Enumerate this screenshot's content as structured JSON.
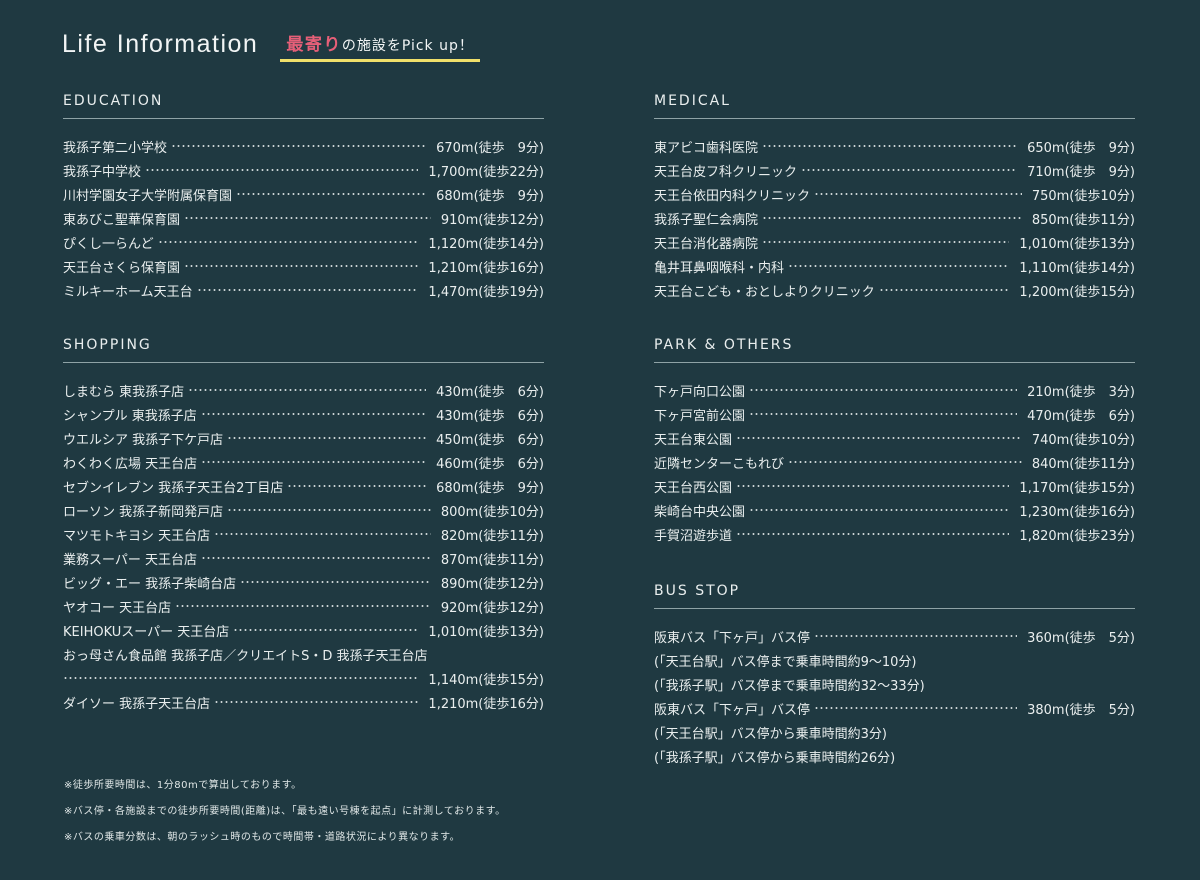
{
  "header": {
    "title": "Life Information",
    "pickup_highlight": "最寄り",
    "pickup_rest": "の施設をPick up！"
  },
  "education": {
    "title": "EDUCATION",
    "rows": [
      {
        "name": "我孫子第二小学校",
        "dist": "670m(徒歩　9分)"
      },
      {
        "name": "我孫子中学校",
        "dist": "1,700m(徒歩22分)"
      },
      {
        "name": "川村学園女子大学附属保育園",
        "dist": "680m(徒歩　9分)"
      },
      {
        "name": "東あびこ聖華保育園",
        "dist": "910m(徒歩12分)"
      },
      {
        "name": "ぴくし一らんど",
        "dist": "1,120m(徒歩14分)"
      },
      {
        "name": "天王台さくら保育園",
        "dist": "1,210m(徒歩16分)"
      },
      {
        "name": "ミルキーホーム天王台",
        "dist": "1,470m(徒歩19分)"
      }
    ]
  },
  "shopping": {
    "title": "SHOPPING",
    "rows": [
      {
        "name": "しまむら 東我孫子店",
        "dist": "430m(徒歩　6分)"
      },
      {
        "name": "シャンプル 東我孫子店",
        "dist": "430m(徒歩　6分)"
      },
      {
        "name": "ウエルシア 我孫子下ケ戸店",
        "dist": "450m(徒歩　6分)"
      },
      {
        "name": "わくわく広場 天王台店",
        "dist": "460m(徒歩　6分)"
      },
      {
        "name": "セブンイレブン 我孫子天王台2丁目店",
        "dist": "680m(徒歩　9分)"
      },
      {
        "name": "ローソン 我孫子新岡発戸店",
        "dist": "800m(徒歩10分)"
      },
      {
        "name": "マツモトキヨシ 天王台店",
        "dist": "820m(徒歩11分)"
      },
      {
        "name": "業務スーパー 天王台店",
        "dist": "870m(徒歩11分)"
      },
      {
        "name": "ビッグ・エー 我孫子柴崎台店",
        "dist": "890m(徒歩12分)"
      },
      {
        "name": "ヤオコー 天王台店",
        "dist": "920m(徒歩12分)"
      },
      {
        "name": "KEIHOKUスーパー 天王台店",
        "dist": "1,010m(徒歩13分)"
      }
    ],
    "long_name": "おっ母さん食品館 我孫子店／クリエイトS・D 我孫子天王台店",
    "long_dist": "1,140m(徒歩15分)",
    "last": {
      "name": "ダイソー 我孫子天王台店",
      "dist": "1,210m(徒歩16分)"
    }
  },
  "medical": {
    "title": "MEDICAL",
    "rows": [
      {
        "name": "東アビコ歯科医院",
        "dist": "650m(徒歩　9分)"
      },
      {
        "name": "天王台皮フ科クリニック",
        "dist": "710m(徒歩　9分)"
      },
      {
        "name": "天王台依田内科クリニック",
        "dist": "750m(徒歩10分)"
      },
      {
        "name": "我孫子聖仁会病院",
        "dist": "850m(徒歩11分)"
      },
      {
        "name": "天王台消化器病院",
        "dist": "1,010m(徒歩13分)"
      },
      {
        "name": "亀井耳鼻咽喉科・内科",
        "dist": "1,110m(徒歩14分)"
      },
      {
        "name": "天王台こども・おとしよりクリニック",
        "dist": "1,200m(徒歩15分)"
      }
    ]
  },
  "park": {
    "title": "PARK & OTHERS",
    "rows": [
      {
        "name": "下ヶ戸向口公園",
        "dist": "210m(徒歩　3分)"
      },
      {
        "name": "下ヶ戸宮前公園",
        "dist": "470m(徒歩　6分)"
      },
      {
        "name": "天王台東公園",
        "dist": "740m(徒歩10分)"
      },
      {
        "name": "近隣センターこもれび",
        "dist": "840m(徒歩11分)"
      },
      {
        "name": "天王台西公園",
        "dist": "1,170m(徒歩15分)"
      },
      {
        "name": "柴崎台中央公園",
        "dist": "1,230m(徒歩16分)"
      },
      {
        "name": "手賀沼遊歩道",
        "dist": "1,820m(徒歩23分)"
      }
    ]
  },
  "bus": {
    "title": "BUS STOP",
    "stop1": {
      "name": "阪東バス「下ヶ戸」バス停",
      "dist": "360m(徒歩　5分)"
    },
    "note1": "(「天王台駅」バス停まで乗車時間約9〜10分)",
    "note2": "(「我孫子駅」バス停まで乗車時間約32〜33分)",
    "stop2": {
      "name": "阪東バス「下ヶ戸」バス停",
      "dist": "380m(徒歩　5分)"
    },
    "note3": "(「天王台駅」バス停から乗車時間約3分)",
    "note4": "(「我孫子駅」バス停から乗車時間約26分)"
  },
  "footnotes": [
    "※徒歩所要時間は、1分80mで算出しております。",
    "※バス停・各施設までの徒歩所要時間(距離)は、「最も遠い号棟を起点」に計測しております。",
    "※バスの乗車分数は、朝のラッシュ時のもので時間帯・道路状況により異なります。"
  ]
}
